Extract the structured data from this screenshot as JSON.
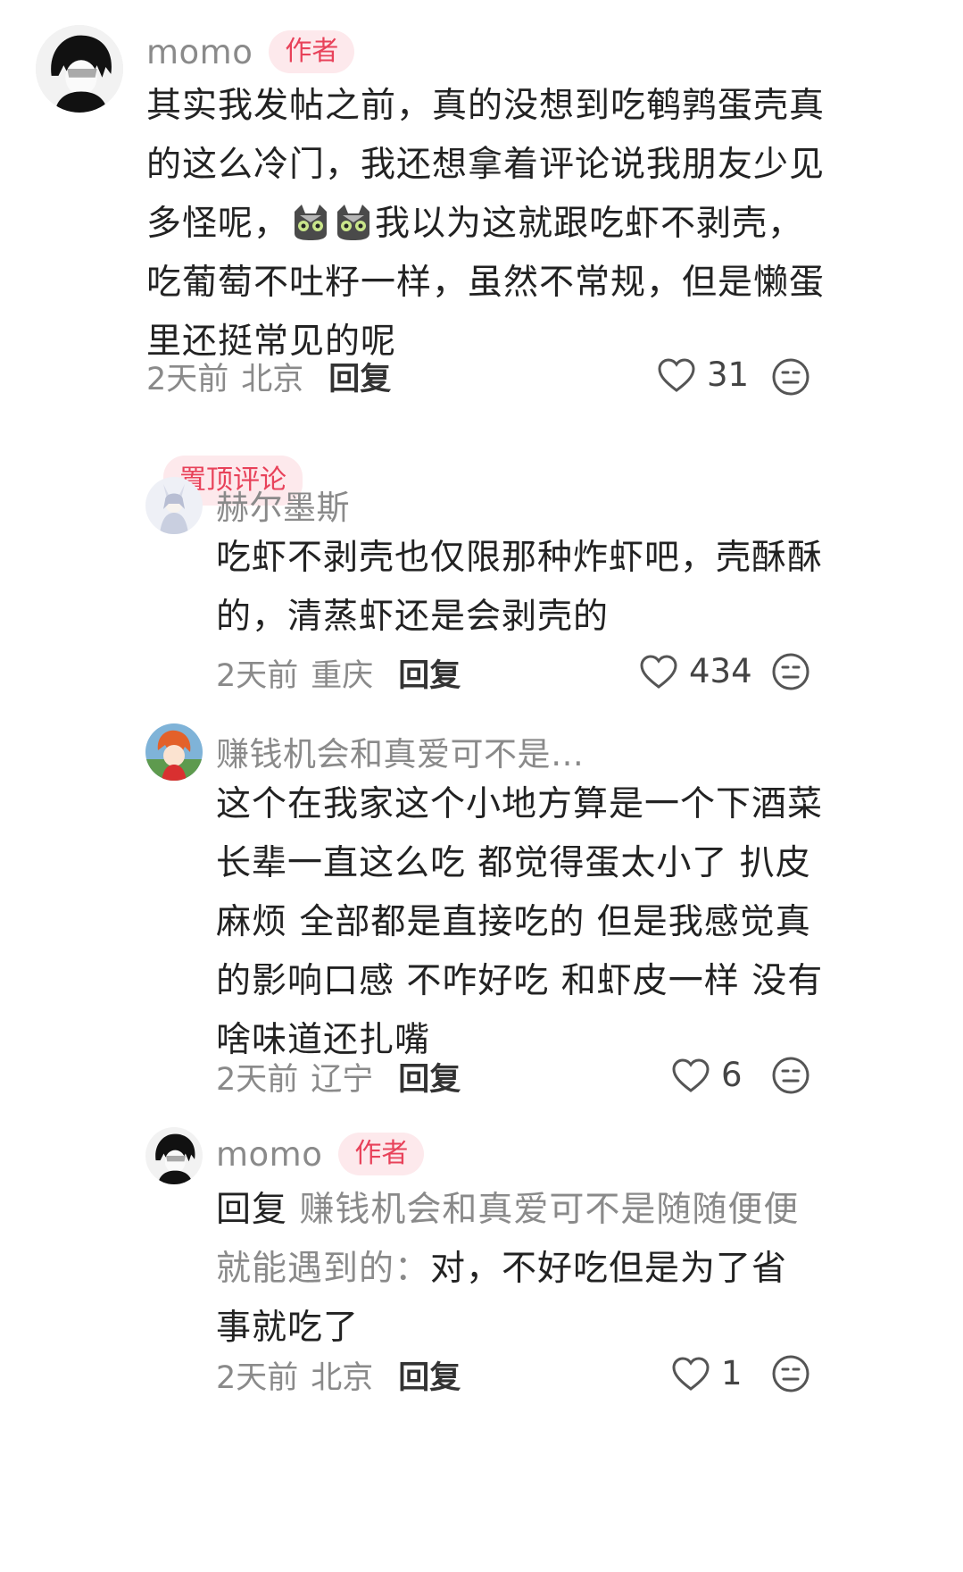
{
  "comments": [
    {
      "username": "momo",
      "badge": "作者",
      "text_before_emoji": "其实我发帖之前，真的没想到吃鹌鹑蛋壳真的这么冷门，我还想拿着评论说我朋友少见多怪呢，",
      "emoji": "cat-emoji",
      "text_after_emoji": "我以为这就跟吃虾不剥壳，吃葡萄不吐籽一样，虽然不常规，但是懒蛋里还挺常见的呢",
      "time": "2天前",
      "location": "北京",
      "reply_label": "回复",
      "likes": "31",
      "pinned_label": "置顶评论"
    },
    {
      "username": "赫尔墨斯",
      "text": "吃虾不剥壳也仅限那种炸虾吧，壳酥酥的，清蒸虾还是会剥壳的",
      "time": "2天前",
      "location": "重庆",
      "reply_label": "回复",
      "likes": "434"
    },
    {
      "username": "赚钱机会和真爱可不是…",
      "text": "这个在我家这个小地方算是一个下酒菜 长辈一直这么吃 都觉得蛋太小了 扒皮麻烦 全部都是直接吃的 但是我感觉真的影响口感 不咋好吃 和虾皮一样 没有啥味道还扎嘴",
      "time": "2天前",
      "location": "辽宁",
      "reply_label": "回复",
      "likes": "6"
    },
    {
      "username": "momo",
      "badge": "作者",
      "reply_prefix": "回复",
      "reply_target": "赚钱机会和真爱可不是随随便便就能遇到的：",
      "text": "对，不好吃但是为了省事就吃了",
      "time": "2天前",
      "location": "北京",
      "reply_label": "回复",
      "likes": "1"
    }
  ],
  "colors": {
    "badge_bg": "#fde9ec",
    "badge_text": "#e8425a",
    "muted": "#8a8a8a",
    "body": "#222222"
  },
  "icons": [
    "heart-icon",
    "emoji-reaction-icon",
    "cat-emoji"
  ]
}
